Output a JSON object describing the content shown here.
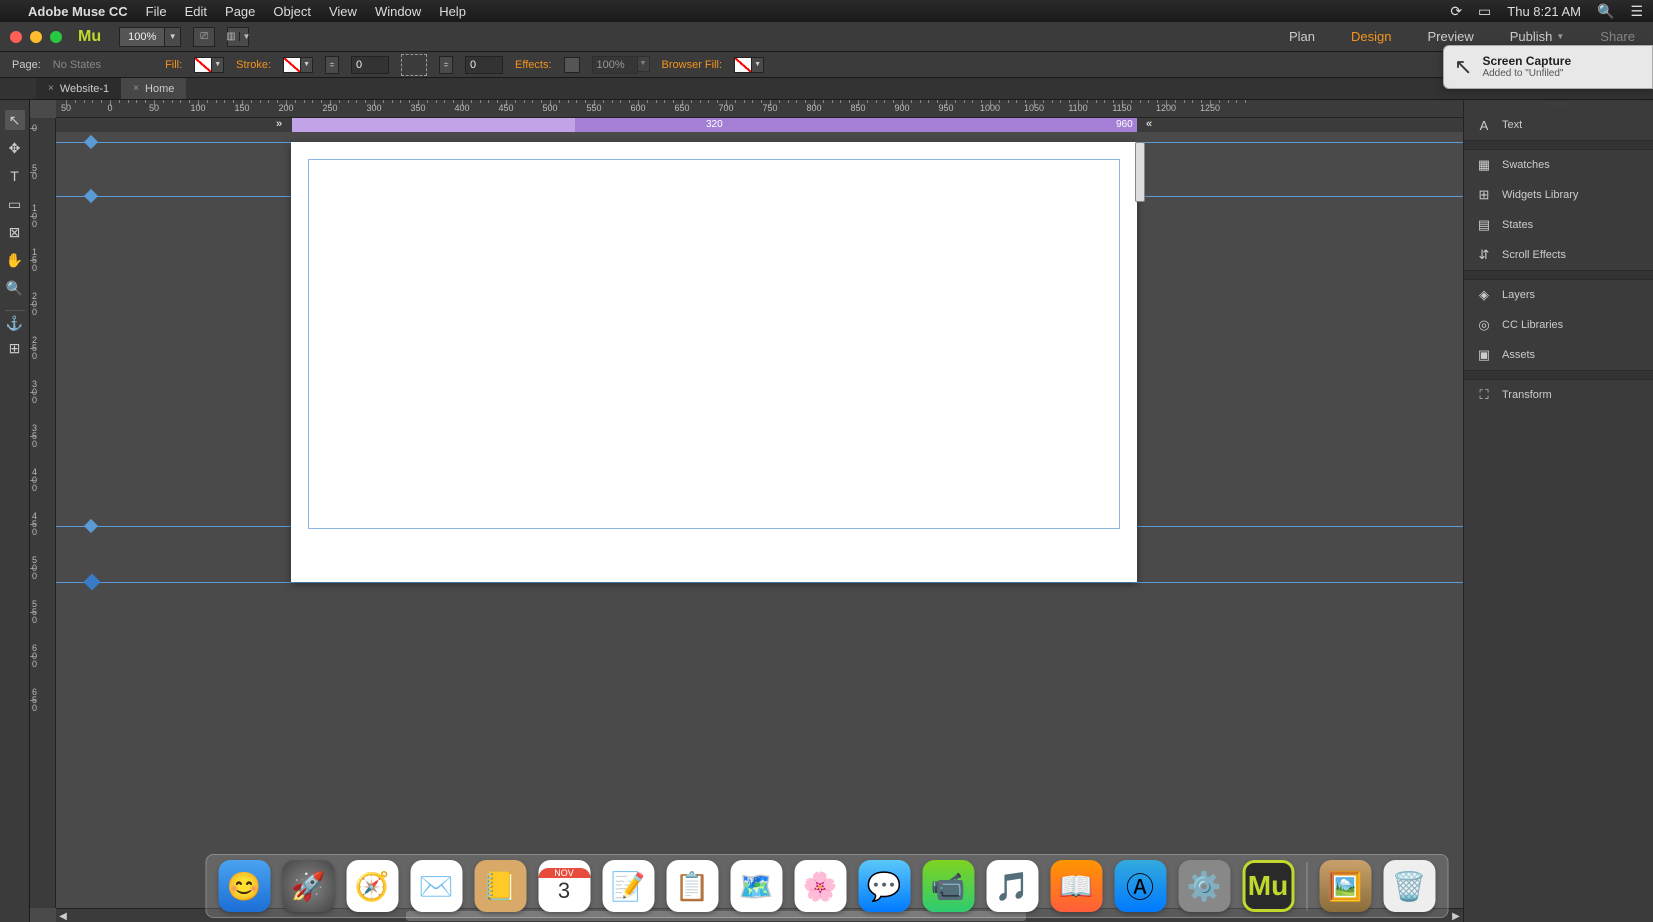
{
  "menubar": {
    "app": "Adobe Muse CC",
    "items": [
      "File",
      "Edit",
      "Page",
      "Object",
      "View",
      "Window",
      "Help"
    ],
    "clock": "Thu 8:21 AM"
  },
  "apptop": {
    "zoom": "100%",
    "modes": [
      "Plan",
      "Design",
      "Preview",
      "Publish",
      "Share"
    ],
    "active_mode": "Design"
  },
  "ctrlbar": {
    "page_label": "Page:",
    "page_value": "No States",
    "fill_label": "Fill:",
    "stroke_label": "Stroke:",
    "stroke_value": "0",
    "corner_value": "0",
    "effects_label": "Effects:",
    "effects_opacity": "100%",
    "browser_fill_label": "Browser Fill:"
  },
  "tabs": [
    {
      "label": "Website-1",
      "active": false
    },
    {
      "label": "Home",
      "active": true
    }
  ],
  "ruler": {
    "h_start": -50,
    "h_step": 50,
    "h_count": 27,
    "v_ticks": [
      0,
      50,
      100,
      150,
      200,
      250,
      300,
      350,
      400,
      450,
      500,
      550,
      600,
      650
    ]
  },
  "breakpoints": {
    "min_label": "320",
    "max_label": "960"
  },
  "right_panels": {
    "group1": [
      "Text"
    ],
    "group2": [
      "Swatches",
      "Widgets Library",
      "States",
      "Scroll Effects"
    ],
    "group3": [
      "Layers",
      "CC Libraries",
      "Assets"
    ],
    "group4": [
      "Transform"
    ]
  },
  "toast": {
    "title": "Screen Capture",
    "sub": "Added to \"Unfiled\""
  },
  "dock": {
    "items": [
      "finder",
      "launchpad",
      "safari",
      "mail",
      "contacts",
      "calendar",
      "notes",
      "reminders",
      "maps",
      "photos",
      "messages",
      "facetime",
      "itunes",
      "ibooks",
      "appstore",
      "sysprefs",
      "muse"
    ],
    "right": [
      "folder",
      "trash"
    ],
    "calendar_month": "NOV",
    "calendar_day": "3"
  }
}
